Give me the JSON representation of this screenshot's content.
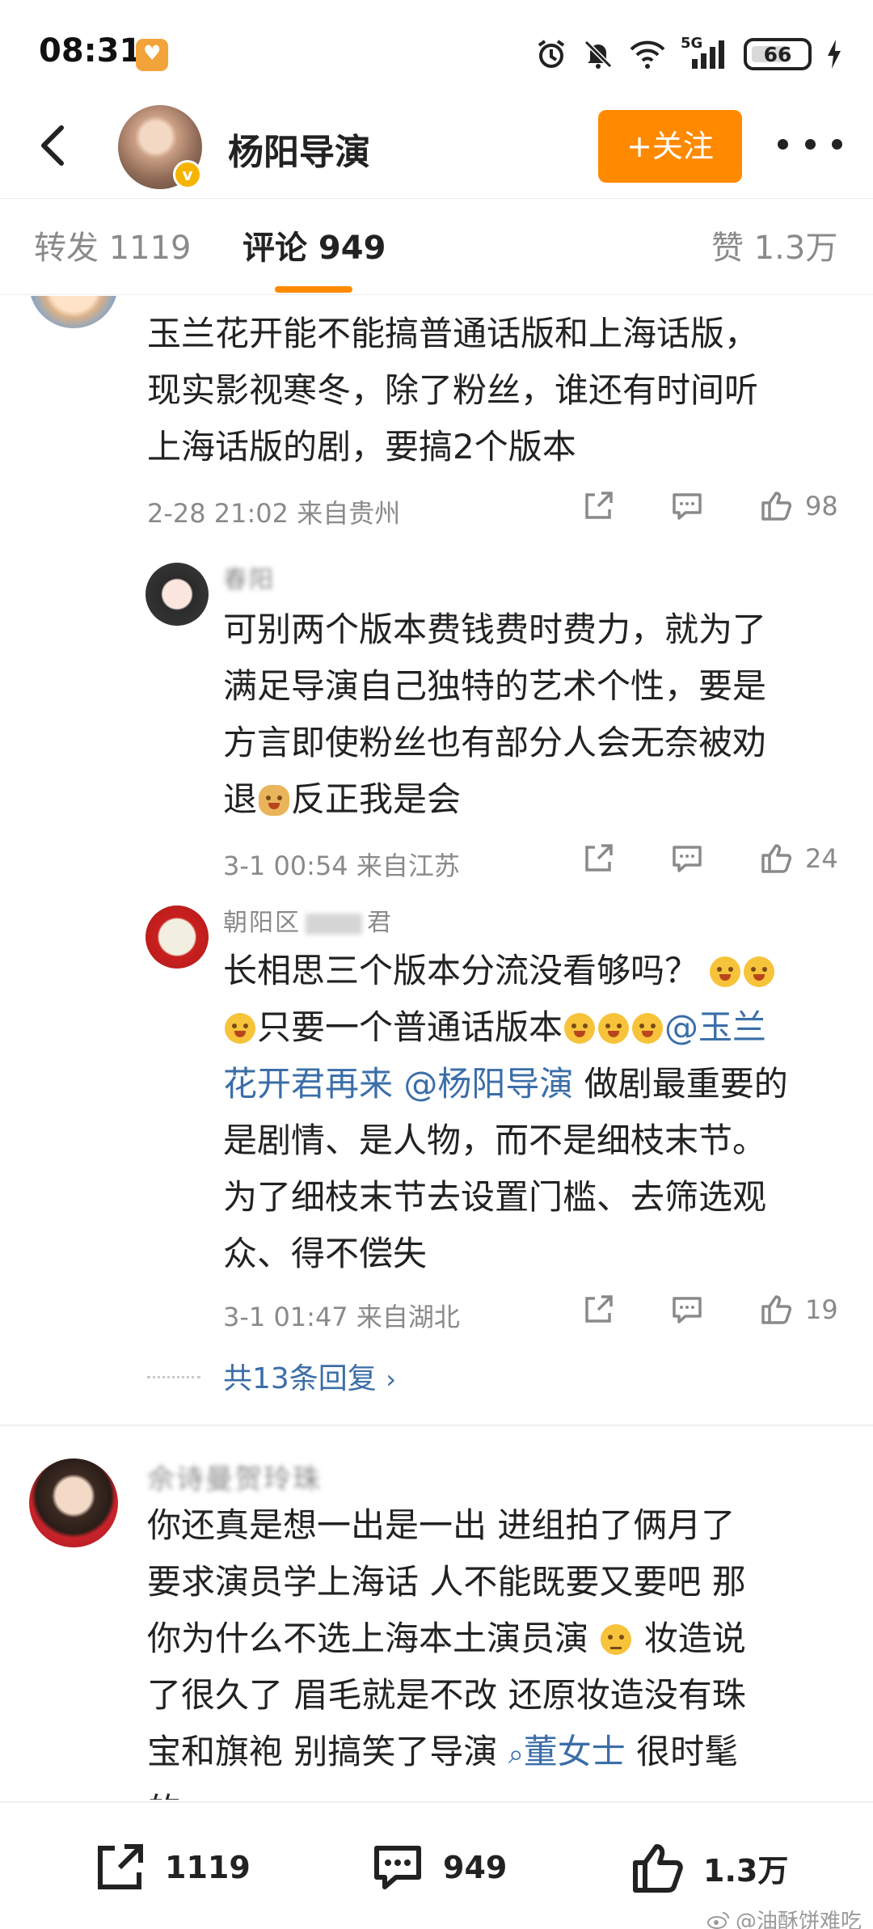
{
  "status_bar": {
    "time": "08:31",
    "network": "5G",
    "battery": "66"
  },
  "header": {
    "user_name": "杨阳导演",
    "follow_label": "+关注"
  },
  "tabs": [
    {
      "label": "转发 1119",
      "active": false
    },
    {
      "label": "评论 949",
      "active": true
    },
    {
      "label": "赞 1.3万",
      "active": false
    }
  ],
  "comments": [
    {
      "text": "玉兰花开能不能搞普通话版和上海话版，现实影视寒冬，除了粉丝，谁还有时间听上海话版的剧，要搞2个版本",
      "line1": "玉兰花开能不能搞普通话版和上海话版，",
      "line2": "现实影视寒冬，除了粉丝，谁还有时间听",
      "line3": "上海话版的剧，要搞2个版本",
      "time": "2-28 21:02 来自贵州",
      "likes": "98"
    },
    {
      "name": "春阳",
      "line1": "可别两个版本费钱费时费力，就为了",
      "line2": "满足导演自己独特的艺术个性，要是",
      "line3": "方言即使粉丝也有部分人会无奈被劝",
      "line4_pre": "退",
      "line4_post": "反正我是会",
      "time": "3-1 00:54 来自江苏",
      "likes": "24"
    },
    {
      "name": "朝阳区",
      "name_suffix": "君",
      "line1": "长相思三个版本分流没看够吗？",
      "line2_text": "只要一个普通话版本",
      "mention1": "@玉兰",
      "line3_mention": "花开君再来",
      "mention2": "@杨阳导演",
      "line3_post": " 做剧最重要的",
      "line4": "是剧情、是人物，而不是细枝末节。",
      "line5": "为了细枝末节去设置门槛、去筛选观",
      "line6": "众、得不偿失",
      "time": "3-1 01:47 来自湖北",
      "likes": "19",
      "more_replies": "共13条回复"
    },
    {
      "name": "佘诗曼贺玲珠",
      "line1": "你还真是想一出是一出 进组拍了俩月了",
      "line2": "要求演员学上海话 人不能既要又要吧 那",
      "line3_pre": "你为什么不选上海本土演员演",
      "line3_post": " 妆造说",
      "line4": "了很久了 眉毛就是不改 还原妆造没有珠",
      "line5_pre": "宝和旗袍 别搞笑了导演 ",
      "line5_link": "董女士",
      "line5_post": " 很时髦",
      "line6": "的"
    }
  ],
  "bottom_bar": {
    "repost": "1119",
    "comment": "949",
    "like": "1.3万"
  },
  "watermark": "@油酥饼难吃",
  "colors": {
    "accent": "#ff8a00",
    "link": "#3b6ea8",
    "muted": "#8a8a8a"
  }
}
